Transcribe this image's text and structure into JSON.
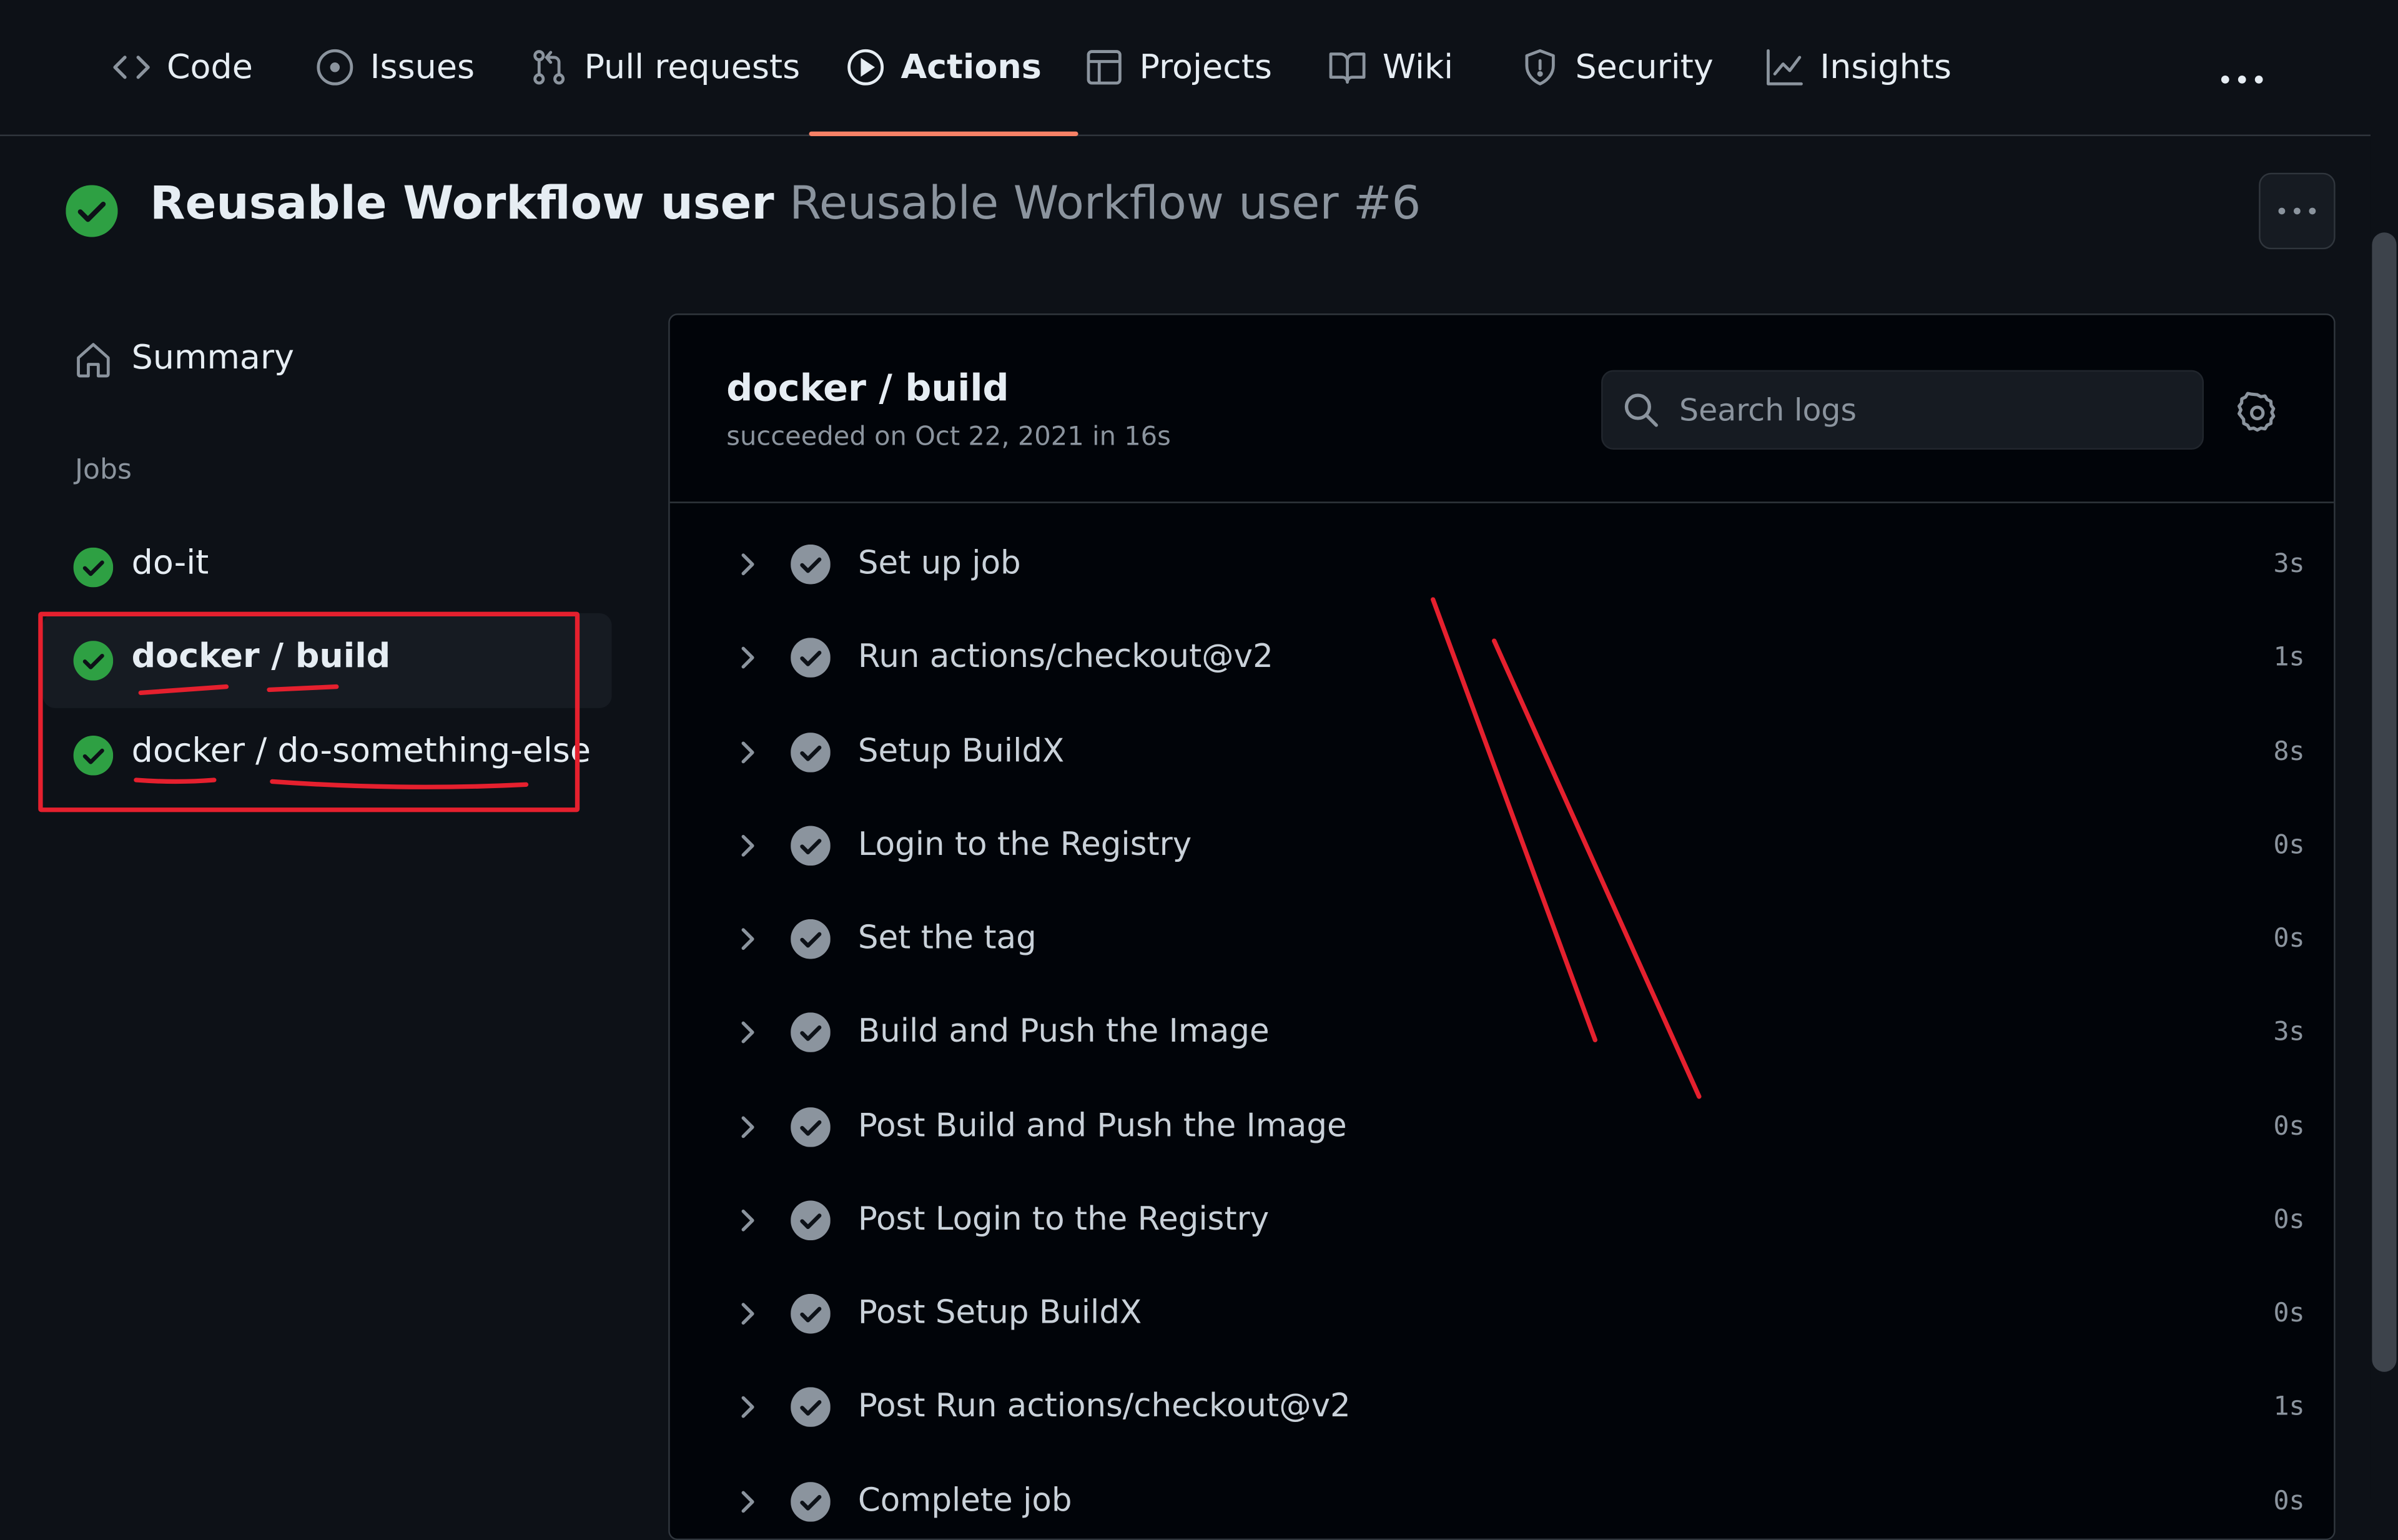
{
  "nav": {
    "tabs": [
      {
        "label": "Code",
        "icon": "code-icon"
      },
      {
        "label": "Issues",
        "icon": "issue-opened-icon"
      },
      {
        "label": "Pull requests",
        "icon": "git-pull-request-icon"
      },
      {
        "label": "Actions",
        "icon": "play-icon",
        "active": true
      },
      {
        "label": "Projects",
        "icon": "table-icon"
      },
      {
        "label": "Wiki",
        "icon": "book-icon"
      },
      {
        "label": "Security",
        "icon": "shield-icon"
      },
      {
        "label": "Insights",
        "icon": "graph-icon"
      }
    ],
    "accent_color": "#f78166"
  },
  "run": {
    "workflow_name": "Reusable Workflow user",
    "run_name": "Reusable Workflow user #6",
    "status": "success",
    "success_color": "#2ea043"
  },
  "sidebar": {
    "summary_label": "Summary",
    "jobs_heading": "Jobs",
    "jobs": [
      {
        "label": "do-it",
        "status": "success"
      },
      {
        "label": "docker / build",
        "status": "success",
        "selected": true
      },
      {
        "label": "docker / do-something-else",
        "status": "success"
      }
    ]
  },
  "job": {
    "title": "docker / build",
    "subtitle": "succeeded on Oct 22, 2021 in 16s",
    "search_placeholder": "Search logs",
    "steps": [
      {
        "name": "Set up job",
        "duration": "3s"
      },
      {
        "name": "Run actions/checkout@v2",
        "duration": "1s"
      },
      {
        "name": "Setup BuildX",
        "duration": "8s"
      },
      {
        "name": "Login to the Registry",
        "duration": "0s"
      },
      {
        "name": "Set the tag",
        "duration": "0s"
      },
      {
        "name": "Build and Push the Image",
        "duration": "3s"
      },
      {
        "name": "Post Build and Push the Image",
        "duration": "0s"
      },
      {
        "name": "Post Login to the Registry",
        "duration": "0s"
      },
      {
        "name": "Post Setup BuildX",
        "duration": "0s"
      },
      {
        "name": "Post Run actions/checkout@v2",
        "duration": "1s"
      },
      {
        "name": "Complete job",
        "duration": "0s"
      }
    ]
  },
  "annotation_color": "#e5202e"
}
